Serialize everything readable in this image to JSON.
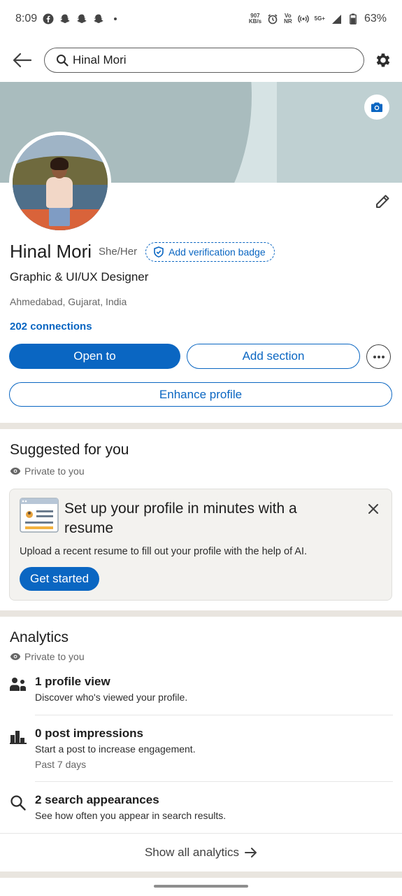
{
  "status_bar": {
    "time": "8:09",
    "speed_value": "907",
    "speed_unit": "KB/s",
    "volte_top": "Vo",
    "volte_bottom": "NR",
    "network": "5G+",
    "battery": "63%"
  },
  "top_bar": {
    "search_value": "Hinal Mori"
  },
  "profile": {
    "name": "Hinal Mori",
    "pronouns": "She/Her",
    "verification_badge": "Add verification badge",
    "headline": "Graphic & UI/UX Designer",
    "location": "Ahmedabad, Gujarat, India",
    "connections": "202 connections"
  },
  "actions": {
    "open_to": "Open to",
    "add_section": "Add section",
    "enhance_profile": "Enhance profile"
  },
  "suggested": {
    "title": "Suggested for you",
    "privacy": "Private to you",
    "card": {
      "title": "Set up your profile in minutes with a resume",
      "description": "Upload a recent resume to fill out your profile with the help of AI.",
      "button": "Get started"
    }
  },
  "analytics": {
    "title": "Analytics",
    "privacy": "Private to you",
    "items": [
      {
        "icon": "people-icon",
        "title": "1 profile view",
        "subtitle": "Discover who's viewed your profile.",
        "note": ""
      },
      {
        "icon": "bar-chart-icon",
        "title": "0 post impressions",
        "subtitle": "Start a post to increase engagement.",
        "note": "Past 7 days"
      },
      {
        "icon": "search-icon",
        "title": "2 search appearances",
        "subtitle": "See how often you appear in search results.",
        "note": ""
      }
    ],
    "show_all": "Show all analytics"
  },
  "colors": {
    "brand_blue": "#0a66c2",
    "divider": "#e9e5df",
    "banner": "#a9bcbe"
  }
}
